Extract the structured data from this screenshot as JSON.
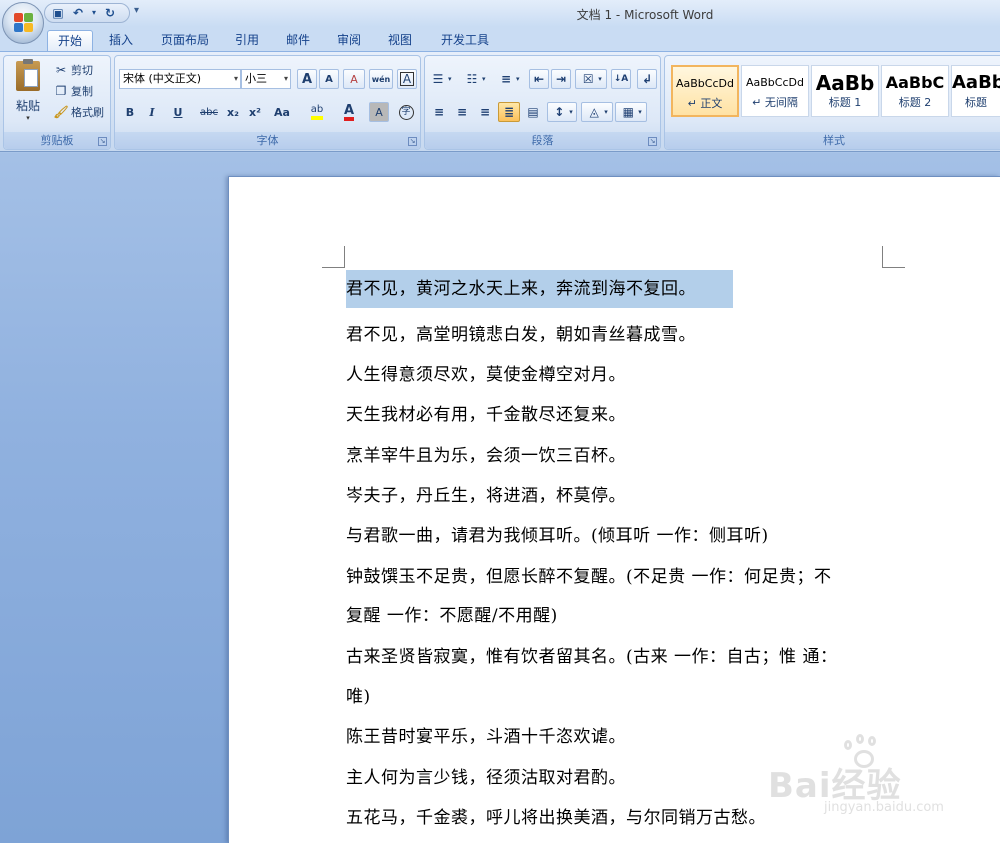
{
  "window": {
    "title": "文档 1 - Microsoft Word"
  },
  "quick_access": {
    "icons": [
      "save-icon",
      "undo-icon",
      "redo-icon"
    ],
    "more": "▾"
  },
  "tabs": [
    {
      "label": "开始",
      "active": true
    },
    {
      "label": "插入"
    },
    {
      "label": "页面布局"
    },
    {
      "label": "引用"
    },
    {
      "label": "邮件"
    },
    {
      "label": "审阅"
    },
    {
      "label": "视图"
    },
    {
      "label": "开发工具"
    }
  ],
  "clipboard": {
    "label": "剪贴板",
    "paste": "粘贴",
    "cut": "剪切",
    "copy": "复制",
    "format_painter": "格式刷"
  },
  "font": {
    "label": "字体",
    "font_name": "宋体 (中文正文)",
    "font_size": "小三",
    "buttons": {
      "bold": "B",
      "italic": "I",
      "underline": "U",
      "strike": "abc",
      "subscript": "x₂",
      "superscript": "x²",
      "change_case": "Aa",
      "grow": "A",
      "shrink": "A",
      "clear": "A",
      "phonetic": "wén",
      "border": "A",
      "shade": "A",
      "enclose": "字"
    }
  },
  "paragraph": {
    "label": "段落"
  },
  "styles": {
    "label": "样式",
    "items": [
      {
        "sample": "AaBbCcDd",
        "name": "↵ 正文",
        "selected": true
      },
      {
        "sample": "AaBbCcDd",
        "name": "↵ 无间隔"
      },
      {
        "sample": "AaBb",
        "name": "标题 1"
      },
      {
        "sample": "AaBbC",
        "name": "标题 2"
      },
      {
        "sample": "AaBb",
        "name": "标题"
      }
    ]
  },
  "document": {
    "lines": [
      "君不见，黄河之水天上来，奔流到海不复回。",
      "君不见，高堂明镜悲白发，朝如青丝暮成雪。",
      "人生得意须尽欢，莫使金樽空对月。",
      "天生我材必有用，千金散尽还复来。",
      "烹羊宰牛且为乐，会须一饮三百杯。",
      "岑夫子，丹丘生，将进酒，杯莫停。",
      "与君歌一曲，请君为我倾耳听。(倾耳听  一作：侧耳听)",
      "钟鼓馔玉不足贵，但愿长醉不复醒。(不足贵  一作：何足贵；不",
      "复醒  一作：不愿醒/不用醒)",
      "古来圣贤皆寂寞，惟有饮者留其名。(古来  一作：自古；惟  通：",
      "唯)",
      "陈王昔时宴平乐，斗酒十千恣欢谑。",
      "主人何为言少钱，径须沽取对君酌。",
      "五花马，千金裘，呼儿将出换美酒，与尔同销万古愁。"
    ],
    "selected_line": 0
  },
  "watermark": {
    "brand": "Bai经验",
    "url": "jingyan.baidu.com"
  },
  "colors": {
    "highlight": "#b3cfea",
    "ribbon": "#dbe6f4",
    "accent": "#15428b"
  }
}
